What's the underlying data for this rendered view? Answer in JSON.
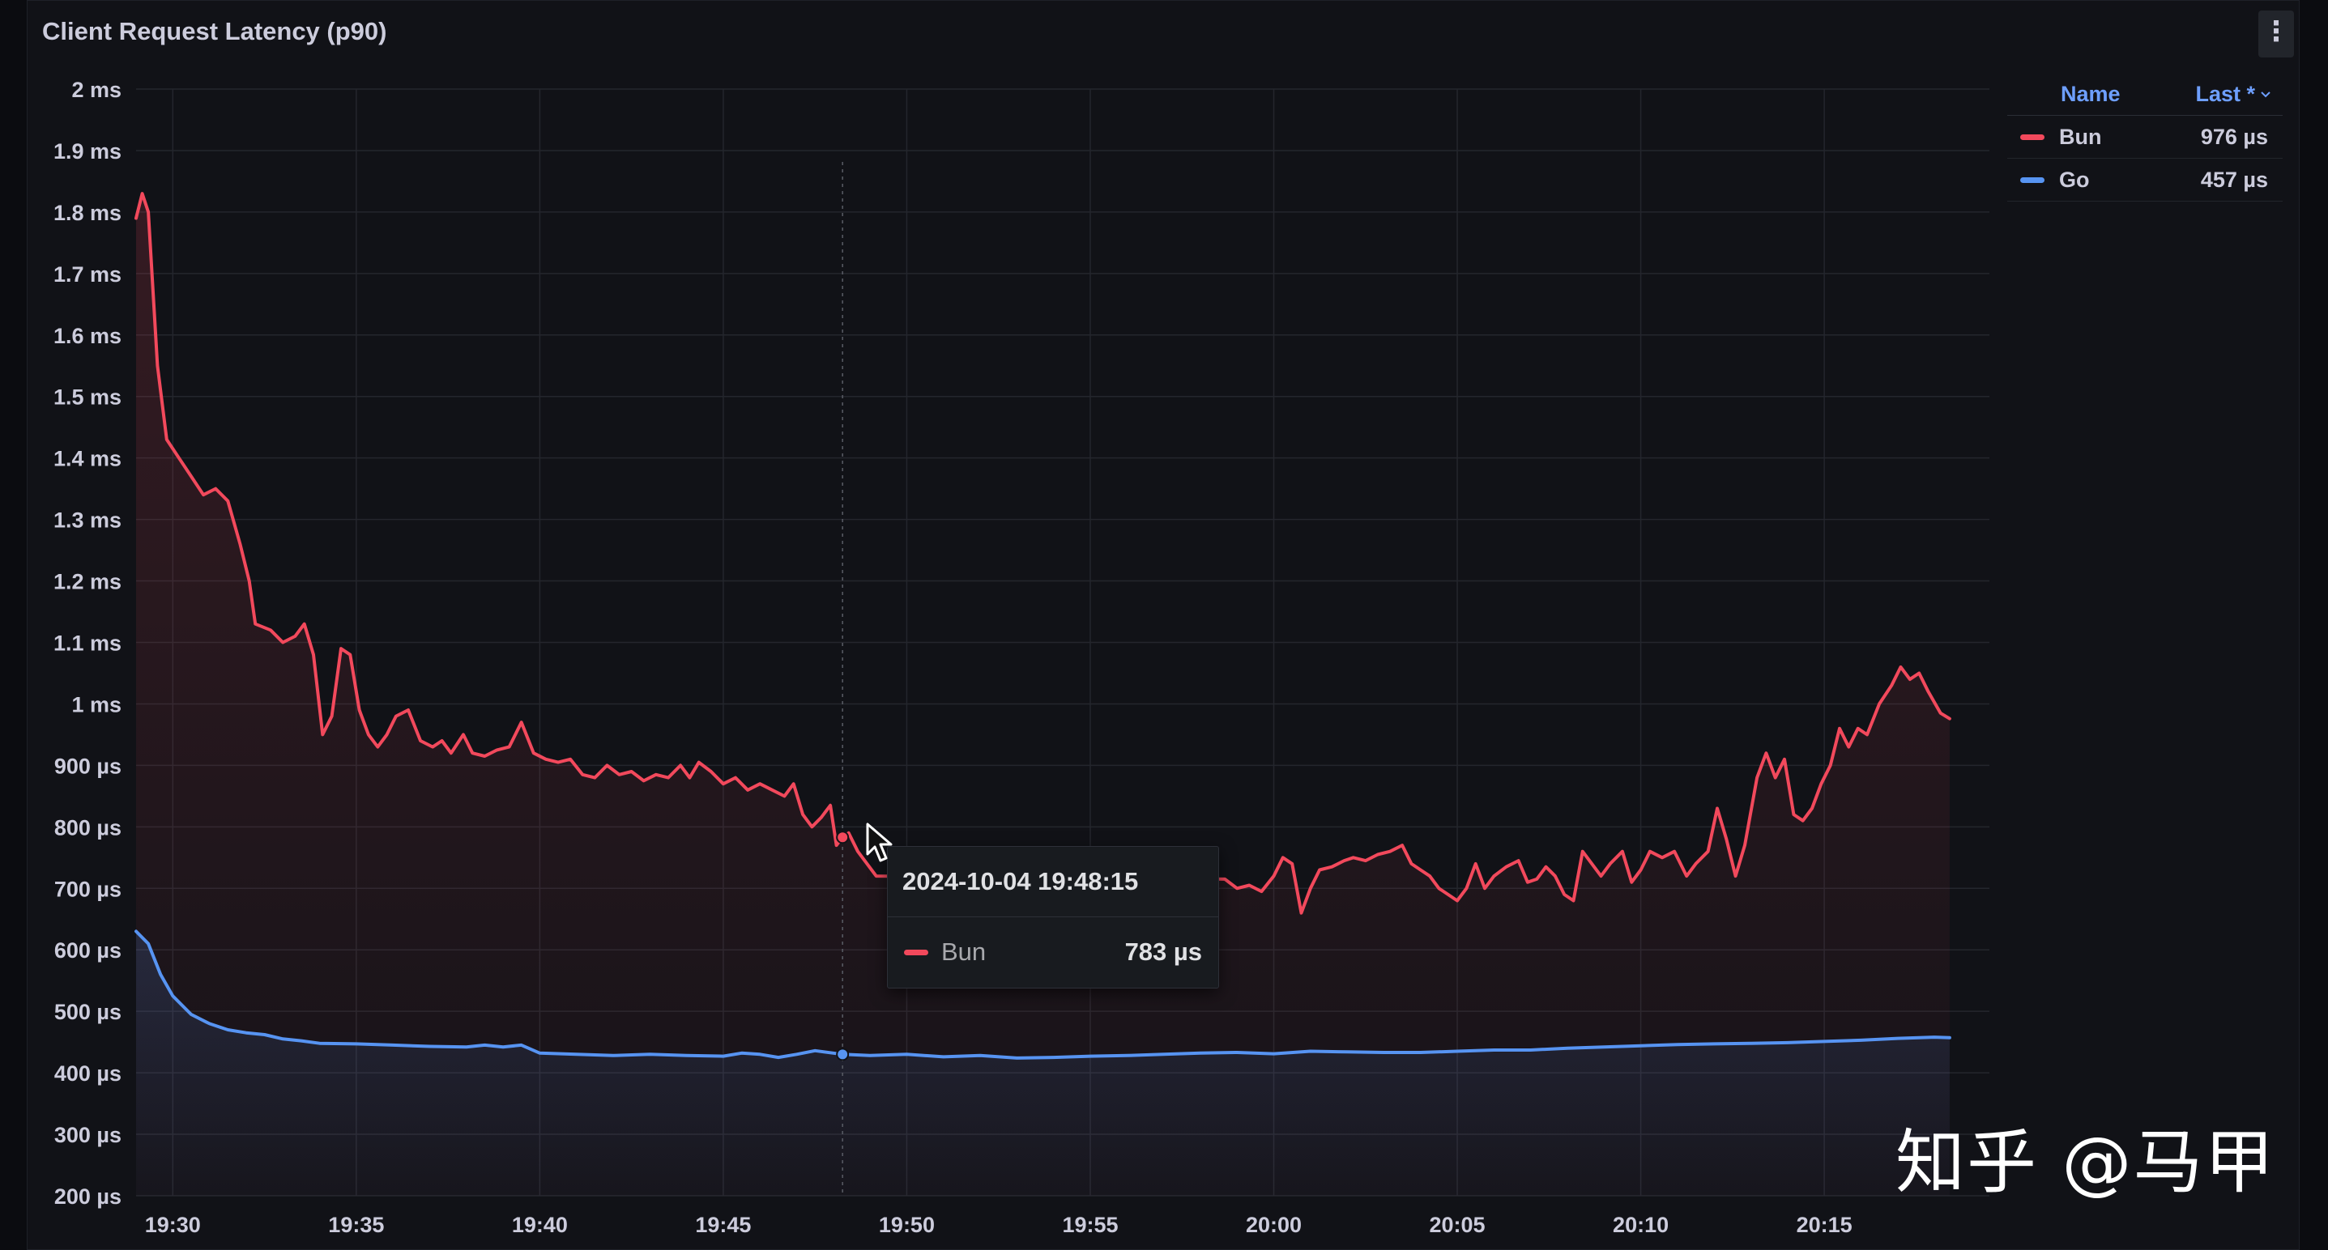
{
  "panel": {
    "title": "Client Request Latency (p90)",
    "menu_icon": "kebab-menu-icon"
  },
  "legend": {
    "name_header": "Name",
    "last_header": "Last *",
    "sort_icon": "chevron-down-icon",
    "items": [
      {
        "name": "Bun",
        "last": "976 µs",
        "color": "#f2495c"
      },
      {
        "name": "Go",
        "last": "457 µs",
        "color": "#5794f2"
      }
    ]
  },
  "tooltip": {
    "time": "2024-10-04 19:48:15",
    "series": "Bun",
    "value": "783 µs",
    "color": "#f2495c"
  },
  "watermark": "知乎 @马甲",
  "chart_data": {
    "type": "line",
    "title": "Client Request Latency (p90)",
    "ylim_us": [
      200,
      2000
    ],
    "y_ticks": [
      {
        "v": 2000,
        "label": "2 ms"
      },
      {
        "v": 1900,
        "label": "1.9 ms"
      },
      {
        "v": 1800,
        "label": "1.8 ms"
      },
      {
        "v": 1700,
        "label": "1.7 ms"
      },
      {
        "v": 1600,
        "label": "1.6 ms"
      },
      {
        "v": 1500,
        "label": "1.5 ms"
      },
      {
        "v": 1400,
        "label": "1.4 ms"
      },
      {
        "v": 1300,
        "label": "1.3 ms"
      },
      {
        "v": 1200,
        "label": "1.2 ms"
      },
      {
        "v": 1100,
        "label": "1.1 ms"
      },
      {
        "v": 1000,
        "label": "1 ms"
      },
      {
        "v": 900,
        "label": "900 µs"
      },
      {
        "v": 800,
        "label": "800 µs"
      },
      {
        "v": 700,
        "label": "700 µs"
      },
      {
        "v": 600,
        "label": "600 µs"
      },
      {
        "v": 500,
        "label": "500 µs"
      },
      {
        "v": 400,
        "label": "400 µs"
      },
      {
        "v": 300,
        "label": "300 µs"
      },
      {
        "v": 200,
        "label": "200 µs"
      }
    ],
    "x_range": [
      "19:29:00",
      "20:19:30"
    ],
    "x_ticks": [
      "19:30",
      "19:35",
      "19:40",
      "19:45",
      "19:50",
      "19:55",
      "20:00",
      "20:05",
      "20:10",
      "20:15"
    ],
    "grid": true,
    "legend_position": "right",
    "hover_time": "19:48:15",
    "series": [
      {
        "name": "Bun",
        "color": "#f2495c",
        "points": [
          [
            "19:29:00",
            1790
          ],
          [
            "19:29:10",
            1830
          ],
          [
            "19:29:20",
            1800
          ],
          [
            "19:29:35",
            1550
          ],
          [
            "19:29:50",
            1430
          ],
          [
            "19:30:10",
            1400
          ],
          [
            "19:30:30",
            1370
          ],
          [
            "19:30:50",
            1340
          ],
          [
            "19:31:10",
            1350
          ],
          [
            "19:31:30",
            1330
          ],
          [
            "19:31:50",
            1260
          ],
          [
            "19:32:05",
            1200
          ],
          [
            "19:32:15",
            1130
          ],
          [
            "19:32:40",
            1120
          ],
          [
            "19:33:00",
            1100
          ],
          [
            "19:33:20",
            1110
          ],
          [
            "19:33:35",
            1130
          ],
          [
            "19:33:50",
            1080
          ],
          [
            "19:34:05",
            950
          ],
          [
            "19:34:20",
            980
          ],
          [
            "19:34:35",
            1090
          ],
          [
            "19:34:50",
            1080
          ],
          [
            "19:35:05",
            990
          ],
          [
            "19:35:20",
            950
          ],
          [
            "19:35:35",
            930
          ],
          [
            "19:35:50",
            950
          ],
          [
            "19:36:05",
            980
          ],
          [
            "19:36:25",
            990
          ],
          [
            "19:36:45",
            940
          ],
          [
            "19:37:05",
            930
          ],
          [
            "19:37:20",
            940
          ],
          [
            "19:37:35",
            920
          ],
          [
            "19:37:55",
            950
          ],
          [
            "19:38:10",
            920
          ],
          [
            "19:38:30",
            915
          ],
          [
            "19:38:50",
            925
          ],
          [
            "19:39:10",
            930
          ],
          [
            "19:39:30",
            970
          ],
          [
            "19:39:50",
            920
          ],
          [
            "19:40:10",
            910
          ],
          [
            "19:40:30",
            905
          ],
          [
            "19:40:50",
            910
          ],
          [
            "19:41:10",
            885
          ],
          [
            "19:41:30",
            880
          ],
          [
            "19:41:50",
            900
          ],
          [
            "19:42:10",
            885
          ],
          [
            "19:42:30",
            890
          ],
          [
            "19:42:50",
            875
          ],
          [
            "19:43:10",
            885
          ],
          [
            "19:43:30",
            880
          ],
          [
            "19:43:50",
            900
          ],
          [
            "19:44:05",
            880
          ],
          [
            "19:44:20",
            905
          ],
          [
            "19:44:40",
            890
          ],
          [
            "19:45:00",
            870
          ],
          [
            "19:45:20",
            880
          ],
          [
            "19:45:40",
            860
          ],
          [
            "19:46:00",
            870
          ],
          [
            "19:46:20",
            860
          ],
          [
            "19:46:40",
            850
          ],
          [
            "19:46:55",
            870
          ],
          [
            "19:47:10",
            820
          ],
          [
            "19:47:25",
            800
          ],
          [
            "19:47:40",
            815
          ],
          [
            "19:47:55",
            835
          ],
          [
            "19:48:05",
            770
          ],
          [
            "19:48:15",
            783
          ],
          [
            "19:48:25",
            790
          ],
          [
            "19:48:40",
            760
          ],
          [
            "19:48:55",
            740
          ],
          [
            "19:49:10",
            720
          ],
          [
            "19:58:40",
            715
          ],
          [
            "19:59:00",
            700
          ],
          [
            "19:59:20",
            705
          ],
          [
            "19:59:40",
            695
          ],
          [
            "20:00:00",
            720
          ],
          [
            "20:00:15",
            750
          ],
          [
            "20:00:30",
            740
          ],
          [
            "20:00:45",
            660
          ],
          [
            "20:01:00",
            700
          ],
          [
            "20:01:15",
            730
          ],
          [
            "20:01:35",
            735
          ],
          [
            "20:01:55",
            745
          ],
          [
            "20:02:10",
            750
          ],
          [
            "20:02:30",
            745
          ],
          [
            "20:02:50",
            755
          ],
          [
            "20:03:10",
            760
          ],
          [
            "20:03:30",
            770
          ],
          [
            "20:03:45",
            740
          ],
          [
            "20:04:00",
            730
          ],
          [
            "20:04:15",
            720
          ],
          [
            "20:04:30",
            700
          ],
          [
            "20:04:45",
            690
          ],
          [
            "20:05:00",
            680
          ],
          [
            "20:05:15",
            700
          ],
          [
            "20:05:30",
            740
          ],
          [
            "20:05:45",
            700
          ],
          [
            "20:06:00",
            720
          ],
          [
            "20:06:20",
            735
          ],
          [
            "20:06:40",
            745
          ],
          [
            "20:06:55",
            710
          ],
          [
            "20:07:10",
            715
          ],
          [
            "20:07:25",
            735
          ],
          [
            "20:07:40",
            720
          ],
          [
            "20:07:55",
            690
          ],
          [
            "20:08:10",
            680
          ],
          [
            "20:08:25",
            760
          ],
          [
            "20:08:40",
            740
          ],
          [
            "20:08:55",
            720
          ],
          [
            "20:09:10",
            740
          ],
          [
            "20:09:30",
            760
          ],
          [
            "20:09:45",
            710
          ],
          [
            "20:10:00",
            730
          ],
          [
            "20:10:15",
            760
          ],
          [
            "20:10:35",
            750
          ],
          [
            "20:10:55",
            760
          ],
          [
            "20:11:15",
            720
          ],
          [
            "20:11:30",
            740
          ],
          [
            "20:11:50",
            760
          ],
          [
            "20:12:05",
            830
          ],
          [
            "20:12:20",
            780
          ],
          [
            "20:12:35",
            720
          ],
          [
            "20:12:50",
            770
          ],
          [
            "20:13:10",
            880
          ],
          [
            "20:13:25",
            920
          ],
          [
            "20:13:40",
            880
          ],
          [
            "20:13:55",
            910
          ],
          [
            "20:14:10",
            820
          ],
          [
            "20:14:25",
            810
          ],
          [
            "20:14:40",
            830
          ],
          [
            "20:14:55",
            870
          ],
          [
            "20:15:10",
            900
          ],
          [
            "20:15:25",
            960
          ],
          [
            "20:15:40",
            930
          ],
          [
            "20:15:55",
            960
          ],
          [
            "20:16:10",
            950
          ],
          [
            "20:16:30",
            1000
          ],
          [
            "20:16:50",
            1030
          ],
          [
            "20:17:05",
            1060
          ],
          [
            "20:17:20",
            1040
          ],
          [
            "20:17:35",
            1050
          ],
          [
            "20:17:50",
            1020
          ],
          [
            "20:18:10",
            985
          ],
          [
            "20:18:25",
            976
          ]
        ]
      },
      {
        "name": "Go",
        "color": "#5794f2",
        "points": [
          [
            "19:29:00",
            630
          ],
          [
            "19:29:20",
            610
          ],
          [
            "19:29:40",
            560
          ],
          [
            "19:30:00",
            525
          ],
          [
            "19:30:30",
            495
          ],
          [
            "19:31:00",
            480
          ],
          [
            "19:31:30",
            470
          ],
          [
            "19:32:00",
            465
          ],
          [
            "19:32:30",
            462
          ],
          [
            "19:33:00",
            455
          ],
          [
            "19:33:30",
            452
          ],
          [
            "19:34:00",
            448
          ],
          [
            "19:35:00",
            447
          ],
          [
            "19:36:00",
            445
          ],
          [
            "19:37:00",
            443
          ],
          [
            "19:38:00",
            442
          ],
          [
            "19:38:30",
            445
          ],
          [
            "19:39:00",
            442
          ],
          [
            "19:39:30",
            445
          ],
          [
            "19:40:00",
            432
          ],
          [
            "19:41:00",
            430
          ],
          [
            "19:42:00",
            428
          ],
          [
            "19:43:00",
            430
          ],
          [
            "19:44:00",
            428
          ],
          [
            "19:45:00",
            427
          ],
          [
            "19:45:30",
            432
          ],
          [
            "19:46:00",
            430
          ],
          [
            "19:46:30",
            425
          ],
          [
            "19:47:00",
            430
          ],
          [
            "19:47:30",
            436
          ],
          [
            "19:48:00",
            432
          ],
          [
            "19:48:15",
            430
          ],
          [
            "19:49:00",
            428
          ],
          [
            "19:50:00",
            430
          ],
          [
            "19:51:00",
            426
          ],
          [
            "19:52:00",
            428
          ],
          [
            "19:53:00",
            424
          ],
          [
            "19:54:00",
            425
          ],
          [
            "19:55:00",
            427
          ],
          [
            "19:56:00",
            428
          ],
          [
            "19:57:00",
            430
          ],
          [
            "19:58:00",
            432
          ],
          [
            "19:59:00",
            433
          ],
          [
            "20:00:00",
            431
          ],
          [
            "20:01:00",
            435
          ],
          [
            "20:02:00",
            434
          ],
          [
            "20:03:00",
            433
          ],
          [
            "20:04:00",
            433
          ],
          [
            "20:05:00",
            435
          ],
          [
            "20:06:00",
            437
          ],
          [
            "20:07:00",
            437
          ],
          [
            "20:08:00",
            440
          ],
          [
            "20:09:00",
            442
          ],
          [
            "20:10:00",
            444
          ],
          [
            "20:11:00",
            446
          ],
          [
            "20:12:00",
            447
          ],
          [
            "20:13:00",
            448
          ],
          [
            "20:14:00",
            449
          ],
          [
            "20:15:00",
            451
          ],
          [
            "20:16:00",
            453
          ],
          [
            "20:17:00",
            456
          ],
          [
            "20:18:00",
            458
          ],
          [
            "20:18:25",
            457
          ]
        ]
      }
    ]
  }
}
